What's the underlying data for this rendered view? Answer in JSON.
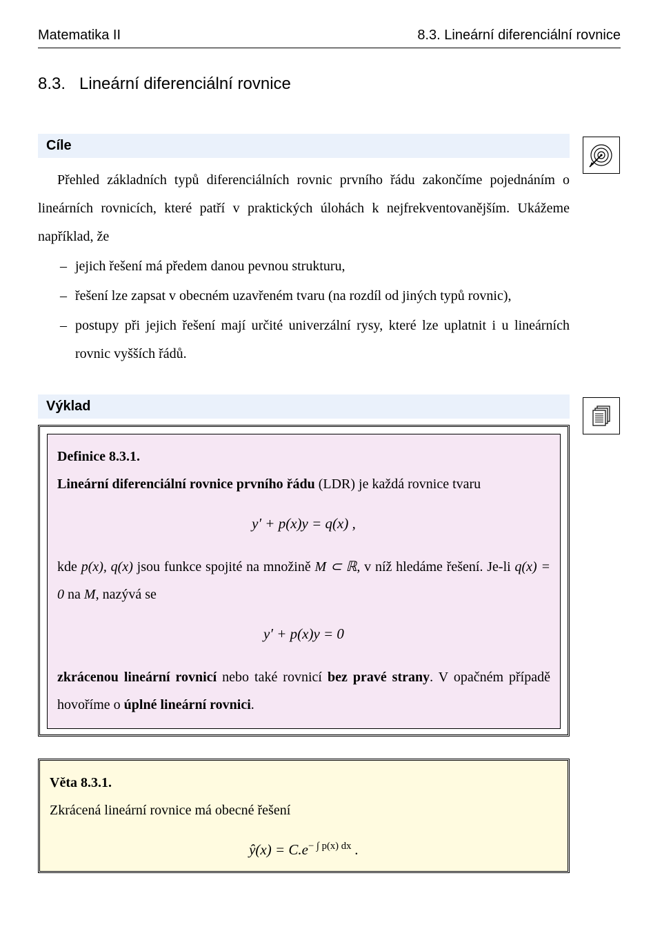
{
  "header": {
    "left": "Matematika II",
    "right": "8.3. Lineární diferenciální rovnice"
  },
  "section": {
    "number": "8.3.",
    "title": "Lineární diferenciální rovnice"
  },
  "cile": {
    "label": "Cíle",
    "p1": "Přehled základních typů diferenciálních rovnic prvního řádu zakončíme pojednáním o lineárních rovnicích, které patří v praktických úlohách k nejfrekventovanějším. Ukážeme například, že",
    "b1": "jejich řešení má předem danou pevnou strukturu,",
    "b2": "řešení lze zapsat v obecném uzavřeném tvaru (na rozdíl od jiných typů rovnic),",
    "b3": "postupy při jejich řešení mají určité univerzální rysy, které lze uplatnit i u lineárních rovnic vyšších řádů."
  },
  "vyklad": {
    "label": "Výklad"
  },
  "definition": {
    "title": "Definice 8.3.1.",
    "line1a": "Lineární diferenciální rovnice prvního řádu",
    "line1b": " (LDR) je každá rovnice tvaru",
    "formula1": "y′ + p(x)y = q(x) ,",
    "line2a": "kde ",
    "line2b": " jsou funkce spojité na množině ",
    "line2c": ", v níž hledáme řešení. Je-li ",
    "line2d": " na ",
    "line2e": ", nazývá se",
    "p_qx": "p(x), q(x)",
    "M_in_R": "M ⊂ ℝ",
    "qx_zero": "q(x) = 0",
    "M": "M",
    "formula2": "y′ + p(x)y = 0",
    "line3a": "zkrácenou lineární rovnicí",
    "line3b": " nebo také rovnicí ",
    "line3c": "bez pravé strany",
    "line3d": ". V opačném případě hovoříme o ",
    "line3e": "úplné lineární rovnici",
    "line3f": "."
  },
  "theorem": {
    "title": "Věta 8.3.1.",
    "line1": "Zkrácená lineární rovnice má obecné řešení",
    "formula_prefix": "ŷ(x) = C.e",
    "formula_exp_html": "− ∫ p(x) dx",
    "formula_suffix": " ."
  },
  "icons": {
    "target": "target-icon",
    "pages": "pages-icon"
  }
}
